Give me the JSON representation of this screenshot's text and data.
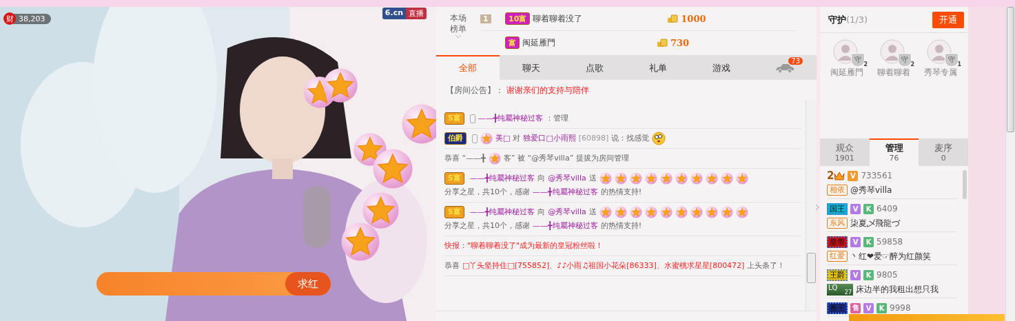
{
  "video": {
    "wealth_icon": "财",
    "wealth": "38,203",
    "logo": "6.cn",
    "logo_tag": "直播",
    "wish_label": "求红"
  },
  "leaderboard": {
    "title": [
      "本场",
      "榜单"
    ],
    "rows": [
      {
        "rank": "1",
        "badge": {
          "text": "10富",
          "color": "#d020c0"
        },
        "name": "聊着聊着没了",
        "amount": "1000"
      },
      {
        "badge": {
          "text": "富",
          "color": "#d020c0"
        },
        "name": "闽延雁門",
        "amount": "730"
      }
    ]
  },
  "chat_tabs": [
    {
      "kind": "text",
      "label": "全部",
      "selected": true
    },
    {
      "kind": "text",
      "label": "聊天",
      "selected": false
    },
    {
      "kind": "text",
      "label": "点歌",
      "selected": false
    },
    {
      "kind": "text",
      "label": "礼单",
      "selected": false
    },
    {
      "kind": "text",
      "label": "游戏",
      "selected": false
    },
    {
      "kind": "car",
      "count": "73",
      "selected": false
    }
  ],
  "announcement": {
    "label": "【房间公告】：",
    "text": "谢谢亲们的支持与陪伴"
  },
  "messages": [
    {
      "kind": "user",
      "badge": {
        "text": "5富",
        "color": "#f0a020"
      },
      "mobile": true,
      "parts": [
        {
          "kind": "name",
          "text": "——╋纯屬神秘过客"
        },
        {
          "kind": "text",
          "text": "：管理"
        }
      ]
    },
    {
      "kind": "user",
      "badge": {
        "text": "伯爵",
        "color": "#1a2a80"
      },
      "mobile": true,
      "parts": [
        {
          "kind": "star"
        },
        {
          "kind": "name",
          "text": "美□"
        },
        {
          "kind": "text",
          "text": "对"
        },
        {
          "kind": "name",
          "text": "独爱口□小雨熙"
        },
        {
          "kind": "id",
          "text": "[60898]"
        },
        {
          "kind": "text",
          "text": "说：找感觉"
        },
        {
          "kind": "emoji"
        }
      ]
    },
    {
      "kind": "system",
      "parts": [
        {
          "kind": "text",
          "text": "恭喜 “——╋"
        },
        {
          "kind": "star"
        },
        {
          "kind": "text",
          "text": "客” 被 “@秀琴villa” 提拔为房间管理"
        }
      ]
    },
    {
      "kind": "user",
      "badge": {
        "text": "5富",
        "color": "#f0a020"
      },
      "mobile": false,
      "parts": [
        {
          "kind": "name",
          "text": "——╋纯屬神秘过客"
        },
        {
          "kind": "text",
          "text": "向"
        },
        {
          "kind": "name",
          "text": "@秀琴villa"
        },
        {
          "kind": "text",
          "text": "送"
        },
        {
          "kind": "star"
        },
        {
          "kind": "star"
        },
        {
          "kind": "star"
        },
        {
          "kind": "star"
        },
        {
          "kind": "star"
        },
        {
          "kind": "star"
        },
        {
          "kind": "star"
        },
        {
          "kind": "star"
        },
        {
          "kind": "star"
        },
        {
          "kind": "star"
        },
        {
          "kind": "text",
          "text": "分享之星，共10个，感谢"
        },
        {
          "kind": "name",
          "text": "——╋纯屬神秘过客"
        },
        {
          "kind": "text",
          "text": "的热情支持!"
        }
      ]
    },
    {
      "kind": "user",
      "badge": {
        "text": "5富",
        "color": "#f0a020"
      },
      "mobile": false,
      "parts": [
        {
          "kind": "name",
          "text": "——╋纯屬神秘过客"
        },
        {
          "kind": "text",
          "text": "向"
        },
        {
          "kind": "name",
          "text": "@秀琴villa"
        },
        {
          "kind": "text",
          "text": "送"
        },
        {
          "kind": "star"
        },
        {
          "kind": "star"
        },
        {
          "kind": "star"
        },
        {
          "kind": "star"
        },
        {
          "kind": "star"
        },
        {
          "kind": "star"
        },
        {
          "kind": "star"
        },
        {
          "kind": "star"
        },
        {
          "kind": "star"
        },
        {
          "kind": "star"
        },
        {
          "kind": "text",
          "text": "分享之星，共10个，感谢"
        },
        {
          "kind": "name",
          "text": "——╋纯屬神秘过客"
        },
        {
          "kind": "text",
          "text": "的热情支持!"
        }
      ]
    },
    {
      "kind": "alert",
      "parts": [
        {
          "kind": "red",
          "text": "快报：\"聊着聊着没了\"成为最新的皇冠粉丝啦！"
        }
      ]
    },
    {
      "kind": "system",
      "parts": [
        {
          "kind": "text",
          "text": "恭喜"
        },
        {
          "kind": "red",
          "text": "□丫头坚持住□[755852]、♪♪小雨♫祖国小花朵[86333]、水蜜桃求星星[800472]"
        },
        {
          "kind": "text",
          "text": "上头条了！"
        }
      ]
    }
  ],
  "guard": {
    "title": "守护",
    "count": "(1/3)",
    "button": "开通",
    "members": [
      {
        "name": "闽延雁門",
        "badge": "守",
        "rank": "2"
      },
      {
        "name": "聊着聊着",
        "badge": "守",
        "rank": "2"
      },
      {
        "name": "秀琴专属",
        "badge": "守",
        "rank": "1"
      }
    ]
  },
  "viewer_tabs": [
    {
      "label": "观众",
      "count": "1901",
      "selected": false
    },
    {
      "label": "管理",
      "count": "76",
      "selected": true
    },
    {
      "label": "麦序",
      "count": "0",
      "selected": false
    }
  ],
  "users": [
    {
      "title": {
        "kind": "crown",
        "text": "2",
        "color": "#a05a10"
      },
      "badges": [
        {
          "text": "V",
          "color": "#f09a30"
        }
      ],
      "id": "733561",
      "tag": {
        "kind": "frame",
        "text": "相依"
      },
      "name": "@秀琴villa"
    },
    {
      "title": {
        "kind": "plate",
        "text": "国王",
        "color": "#10b0d0"
      },
      "badges": [
        {
          "text": "V",
          "color": "#b47ae6"
        },
        {
          "text": "K",
          "color": "#58b87a"
        }
      ],
      "id": "6409",
      "tag": {
        "kind": "frame",
        "text": "东风"
      },
      "name": "柒夏乄飛龍づ"
    },
    {
      "title": {
        "kind": "plate",
        "text": "皇帝",
        "color": "#c01010"
      },
      "badges": [
        {
          "text": "V",
          "color": "#b47ae6"
        },
        {
          "text": "K",
          "color": "#58b87a"
        }
      ],
      "id": "59858",
      "tag": {
        "kind": "frame",
        "text": "红爱"
      },
      "name": "丶红❤爱☞醉为红颜笑"
    },
    {
      "title": {
        "kind": "plate",
        "text": "王爵",
        "color": "#e0c010"
      },
      "badges": [
        {
          "text": "V",
          "color": "#b47ae6"
        },
        {
          "text": "K",
          "color": "#58b87a"
        }
      ],
      "id": "9805",
      "tag": {
        "kind": "lq",
        "text": "LQ",
        "level": "27"
      },
      "name": "床边半的我租出想只我"
    },
    {
      "title": {
        "kind": "plate",
        "text": "番王",
        "color": "#1a2a80"
      },
      "badges": [
        {
          "text": "售",
          "color": "#e060a0"
        },
        {
          "text": "V",
          "color": "#b47ae6"
        },
        {
          "text": "K",
          "color": "#58b87a"
        }
      ],
      "id": "9998"
    }
  ]
}
